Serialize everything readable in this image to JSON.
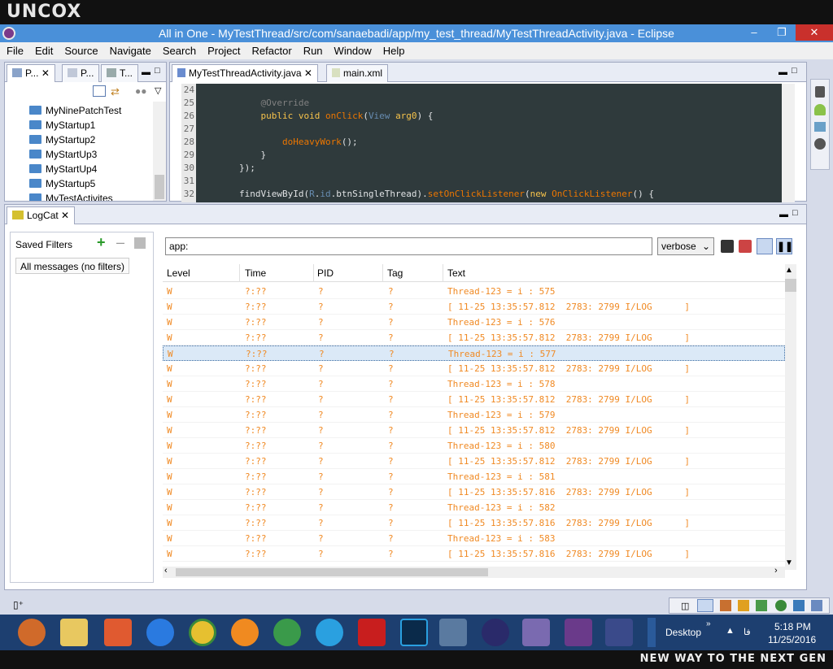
{
  "brand_top": "UNCOX",
  "brand_bottom": "NEW WAY TO THE NEXT GEN",
  "window": {
    "title": "All in One - MyTestThread/src/com/sanaebadi/app/my_test_thread/MyTestThreadActivity.java - Eclipse"
  },
  "menu": [
    "File",
    "Edit",
    "Source",
    "Navigate",
    "Search",
    "Project",
    "Refactor",
    "Run",
    "Window",
    "Help"
  ],
  "explorer": {
    "tabs": [
      "P...",
      "P...",
      "T..."
    ],
    "items": [
      "MyNinePatchTest",
      "MyStartup1",
      "MyStartup2",
      "MyStartUp3",
      "MyStartUp4",
      "MyStartup5",
      "MyTestActivites"
    ]
  },
  "editor": {
    "tabs": [
      "MyTestThreadActivity.java",
      "main.xml"
    ],
    "line_numbers": [
      "24",
      "25",
      "26",
      "27",
      "28",
      "29",
      "30",
      "31",
      "32"
    ]
  },
  "logcat": {
    "tab_label": "LogCat",
    "saved_filters_label": "Saved Filters",
    "filter_item": "All messages (no filters)",
    "search_value": "app:",
    "level_select": "verbose",
    "columns": [
      "Level",
      "Time",
      "PID",
      "Tag",
      "Text"
    ],
    "rows": [
      [
        "W",
        "?:??",
        "?",
        "?",
        "Thread-123 = i : 575"
      ],
      [
        "W",
        "?:??",
        "?",
        "?",
        "[ 11-25 13:35:57.812  2783: 2799 I/LOG      ]"
      ],
      [
        "W",
        "?:??",
        "?",
        "?",
        "Thread-123 = i : 576"
      ],
      [
        "W",
        "?:??",
        "?",
        "?",
        "[ 11-25 13:35:57.812  2783: 2799 I/LOG      ]"
      ],
      [
        "W",
        "?:??",
        "?",
        "?",
        "Thread-123 = i : 577"
      ],
      [
        "W",
        "?:??",
        "?",
        "?",
        "[ 11-25 13:35:57.812  2783: 2799 I/LOG      ]"
      ],
      [
        "W",
        "?:??",
        "?",
        "?",
        "Thread-123 = i : 578"
      ],
      [
        "W",
        "?:??",
        "?",
        "?",
        "[ 11-25 13:35:57.812  2783: 2799 I/LOG      ]"
      ],
      [
        "W",
        "?:??",
        "?",
        "?",
        "Thread-123 = i : 579"
      ],
      [
        "W",
        "?:??",
        "?",
        "?",
        "[ 11-25 13:35:57.812  2783: 2799 I/LOG      ]"
      ],
      [
        "W",
        "?:??",
        "?",
        "?",
        "Thread-123 = i : 580"
      ],
      [
        "W",
        "?:??",
        "?",
        "?",
        "[ 11-25 13:35:57.812  2783: 2799 I/LOG      ]"
      ],
      [
        "W",
        "?:??",
        "?",
        "?",
        "Thread-123 = i : 581"
      ],
      [
        "W",
        "?:??",
        "?",
        "?",
        "[ 11-25 13:35:57.816  2783: 2799 I/LOG      ]"
      ],
      [
        "W",
        "?:??",
        "?",
        "?",
        "Thread-123 = i : 582"
      ],
      [
        "W",
        "?:??",
        "?",
        "?",
        "[ 11-25 13:35:57.816  2783: 2799 I/LOG      ]"
      ],
      [
        "W",
        "?:??",
        "?",
        "?",
        "Thread-123 = i : 583"
      ],
      [
        "W",
        "?:??",
        "?",
        "?",
        "[ 11-25 13:35:57.816  2783: 2799 I/LOG      ]"
      ]
    ],
    "selected_row": 4
  },
  "taskbar": {
    "desktop_label": "Desktop",
    "lang": "فا",
    "time": "5:18 PM",
    "date": "11/25/2016"
  }
}
